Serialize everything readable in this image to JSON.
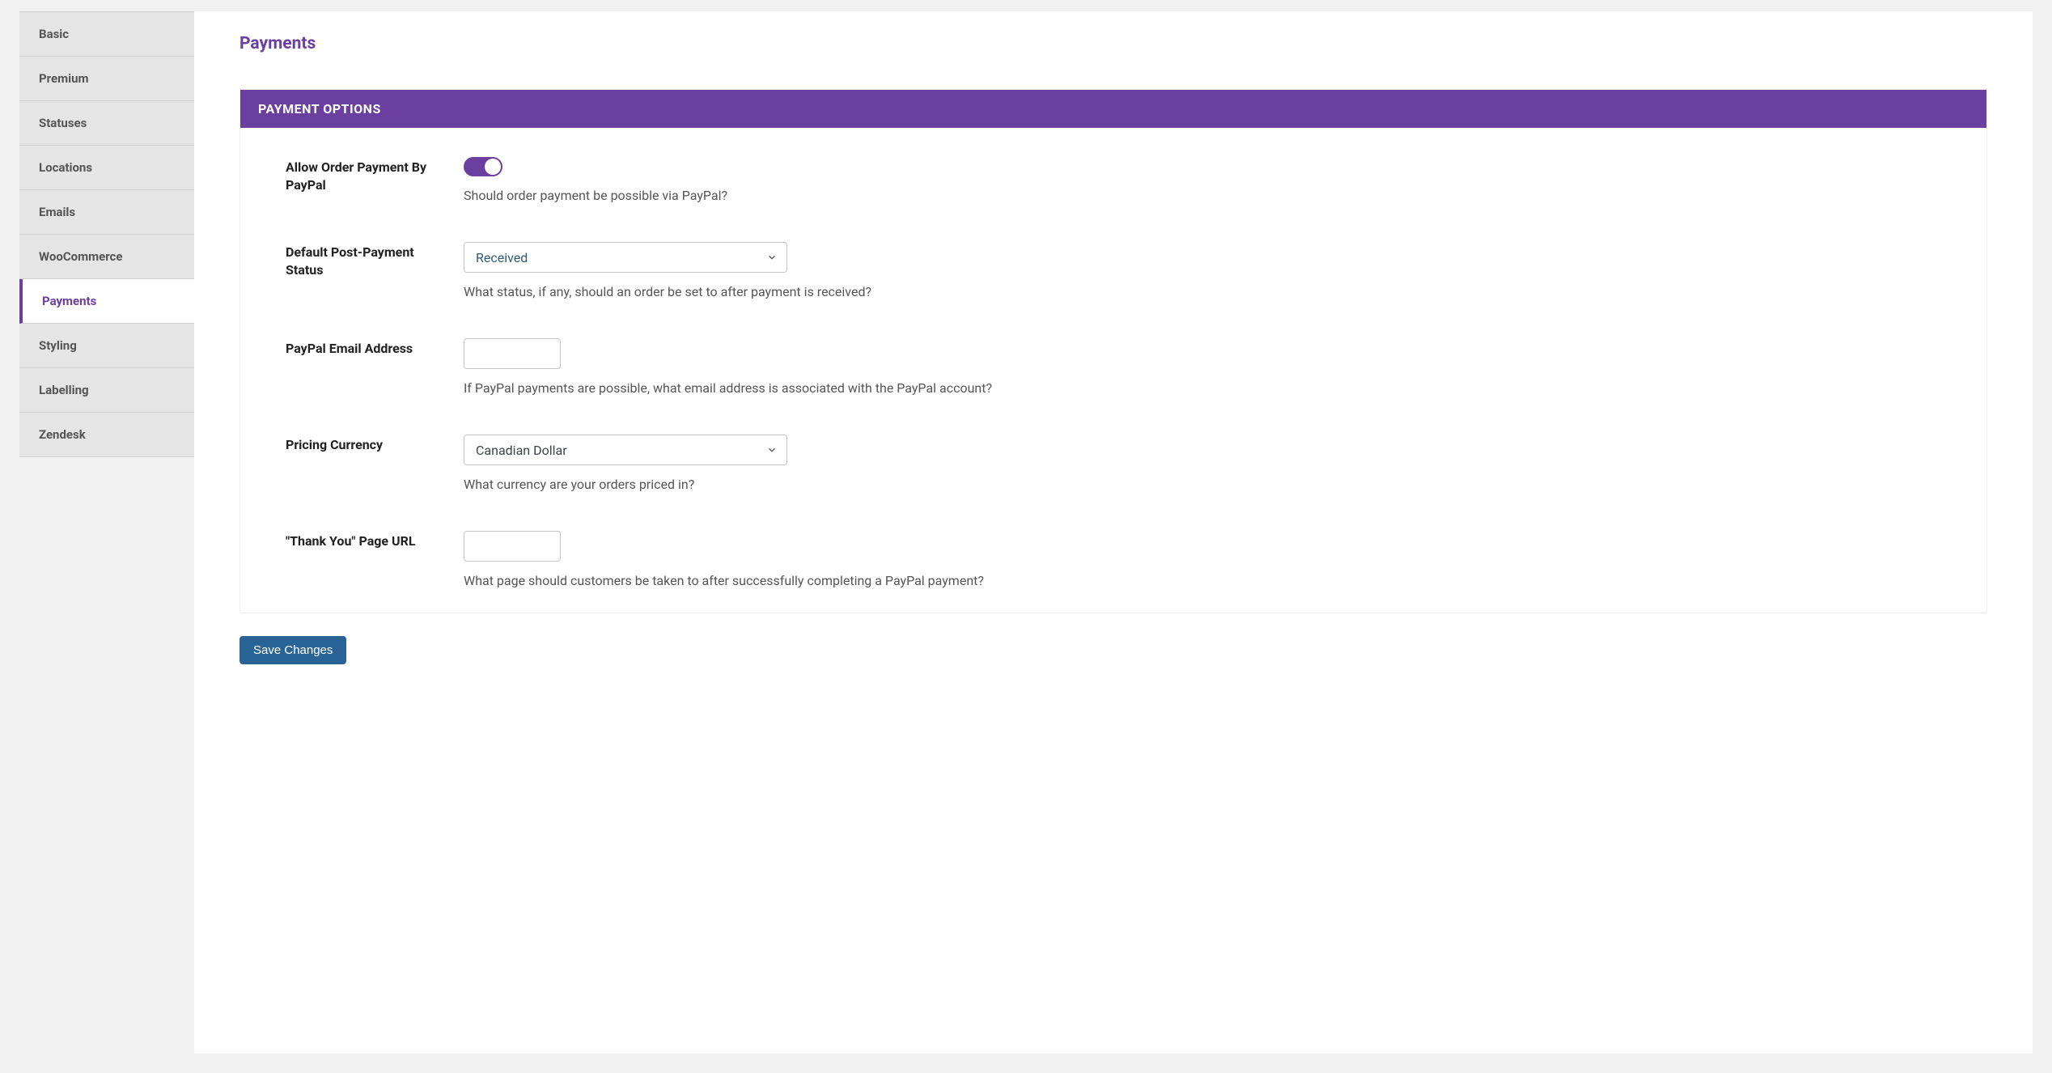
{
  "sidebar": {
    "items": [
      {
        "label": "Basic",
        "active": false
      },
      {
        "label": "Premium",
        "active": false
      },
      {
        "label": "Statuses",
        "active": false
      },
      {
        "label": "Locations",
        "active": false
      },
      {
        "label": "Emails",
        "active": false
      },
      {
        "label": "WooCommerce",
        "active": false
      },
      {
        "label": "Payments",
        "active": true
      },
      {
        "label": "Styling",
        "active": false
      },
      {
        "label": "Labelling",
        "active": false
      },
      {
        "label": "Zendesk",
        "active": false
      }
    ]
  },
  "page": {
    "title": "Payments"
  },
  "panel": {
    "header": "PAYMENT OPTIONS",
    "fields": {
      "allow_paypal": {
        "label": "Allow Order Payment By PayPal",
        "value": true,
        "help": "Should order payment be possible via PayPal?"
      },
      "default_status": {
        "label": "Default Post-Payment Status",
        "value": "Received",
        "help": "What status, if any, should an order be set to after payment is received?"
      },
      "paypal_email": {
        "label": "PayPal Email Address",
        "value": "",
        "help": "If PayPal payments are possible, what email address is associated with the PayPal account?"
      },
      "currency": {
        "label": "Pricing Currency",
        "value": "Canadian Dollar",
        "help": "What currency are your orders priced in?"
      },
      "thank_you_url": {
        "label": "\"Thank You\" Page URL",
        "value": "",
        "help": "What page should customers be taken to after successfully completing a PayPal payment?"
      }
    }
  },
  "buttons": {
    "save": "Save Changes"
  }
}
